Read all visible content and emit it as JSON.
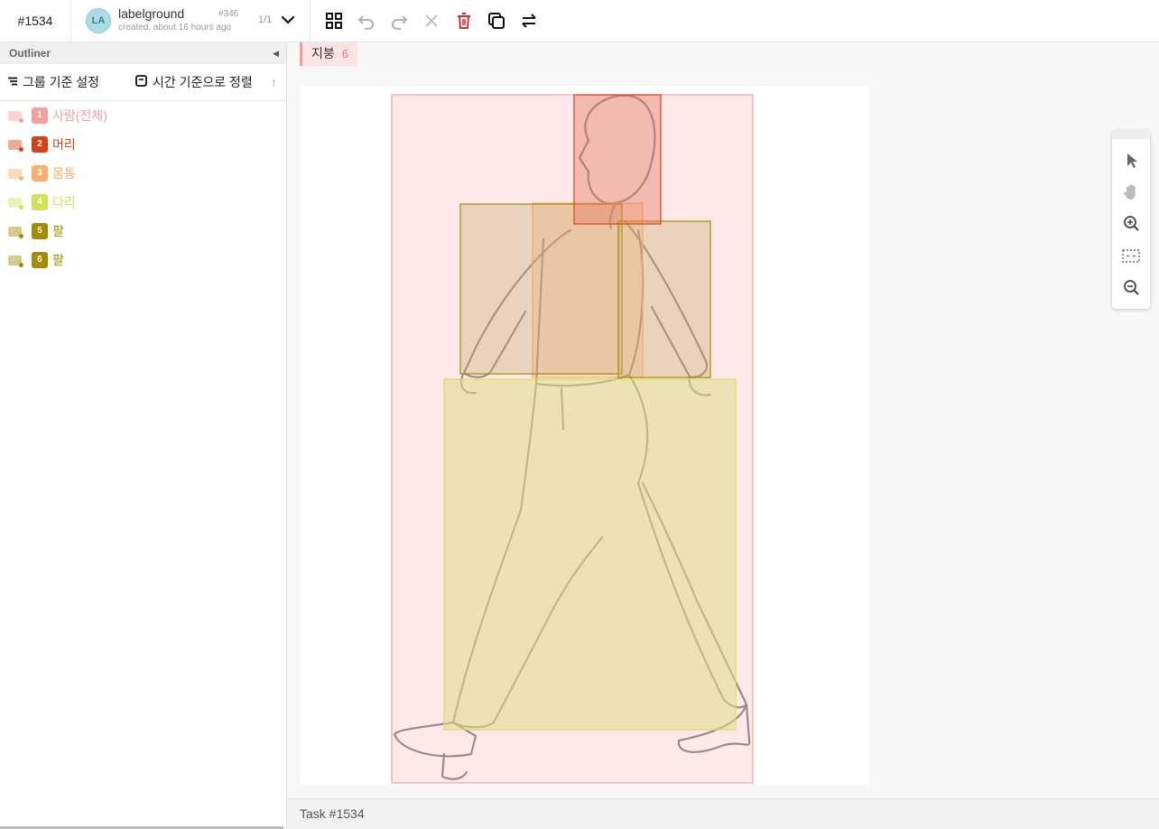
{
  "header": {
    "task_id": "#1534",
    "avatar_initials": "LA",
    "project_name": "labelground",
    "created": "created, about 16 hours ago",
    "project_number": "#346",
    "page_count": "1/1"
  },
  "toolbar": {
    "icons": [
      "grid-icon",
      "undo-icon",
      "redo-icon",
      "close-icon",
      "delete-icon",
      "copy-icon",
      "swap-icon"
    ],
    "delete_color": "#d32f2f"
  },
  "outliner": {
    "title": "Outliner",
    "group_label": "그룹 기준 설정",
    "sort_label": "시간 기준으로 정렬",
    "labels": [
      {
        "num": "1",
        "name": "사람(전체)",
        "color": "#f4a0a0"
      },
      {
        "num": "2",
        "name": "머리",
        "color": "#d84315"
      },
      {
        "num": "3",
        "name": "몸통",
        "color": "#f9b26b"
      },
      {
        "num": "4",
        "name": "다리",
        "color": "#d4e157"
      },
      {
        "num": "5",
        "name": "팔",
        "color": "#a58b00"
      },
      {
        "num": "6",
        "name": "팔",
        "color": "#a58b00"
      }
    ]
  },
  "canvas": {
    "class_tag": "지붕",
    "class_count": "6"
  },
  "footer": {
    "task_label": "Task #1534"
  }
}
